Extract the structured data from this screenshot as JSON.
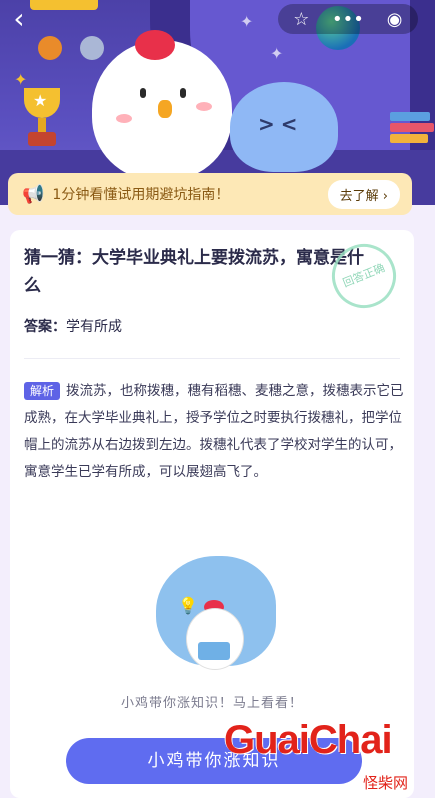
{
  "header": {
    "back_icon": "chevron-left-icon",
    "actions": [
      "star-icon",
      "more-dots-icon",
      "target-icon"
    ]
  },
  "notice": {
    "text": "1分钟看懂试用期避坑指南！",
    "button": "去了解 ›"
  },
  "question": {
    "title": "猜一猜：大学毕业典礼上要拨流苏，寓意是什么",
    "stamp": "回答正确",
    "answer_label": "答案：",
    "answer_value": "学有所成"
  },
  "explanation": {
    "tag": "解析",
    "text": "拨流苏，也称拨穗，穗有稻穗、麦穗之意，拨穗表示它已成熟，在大学毕业典礼上，授予学位之时要执行拨穗礼，把学位帽上的流苏从右边拨到左边。拨穗礼代表了学校对学生的认可，寓意学生已学有所成，可以展翅高飞了。"
  },
  "promo": {
    "text": "小鸡带你涨知识！马上看看！",
    "button": "小鸡带你涨知识"
  },
  "watermark": {
    "main": "GuaiChai",
    "sub": "怪柴网"
  },
  "colors": {
    "hero": "#4c41a8",
    "notice_bg": "#fde8b6",
    "accent": "#5f6cf0",
    "tag": "#5e63e6"
  }
}
